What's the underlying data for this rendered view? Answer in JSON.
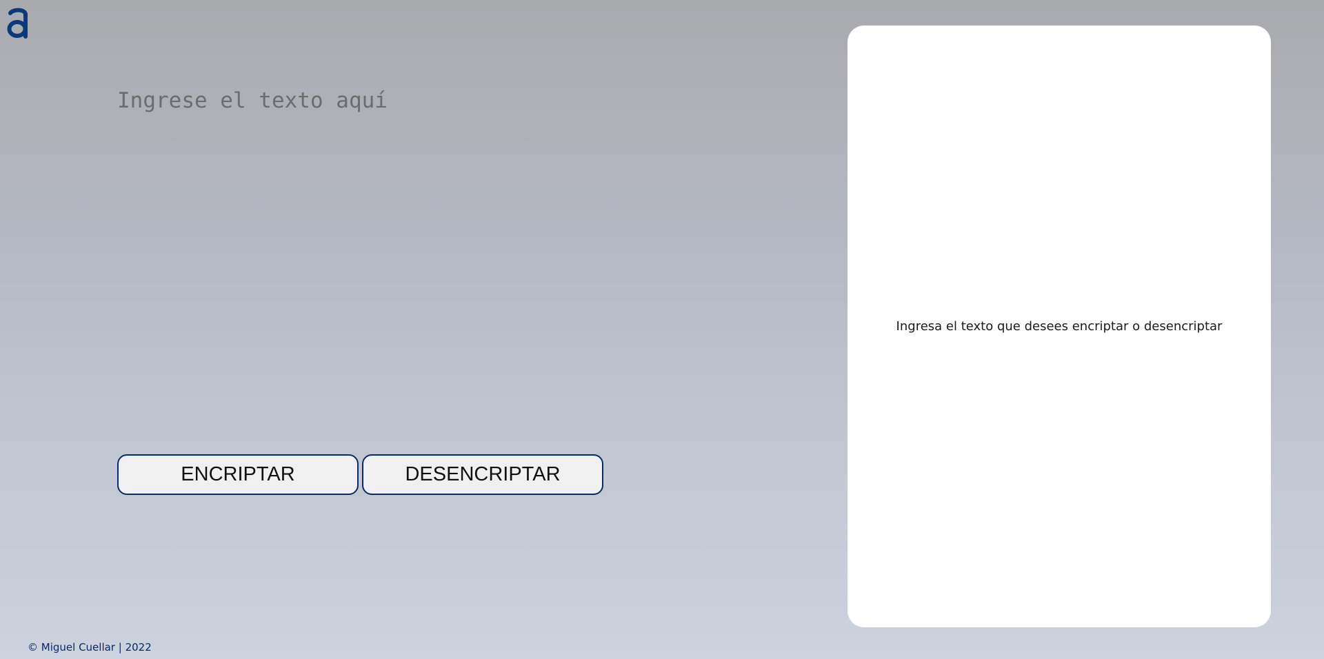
{
  "logo": {
    "icon": "letter-a-logo-icon",
    "color": "#0a3a7a"
  },
  "input": {
    "placeholder": "Ingrese el texto aquí",
    "value": ""
  },
  "buttons": {
    "encrypt_label": "ENCRIPTAR",
    "decrypt_label": "DESENCRIPTAR",
    "border_color": "#0a2a66"
  },
  "output": {
    "message": "Ingresa el texto que desees encriptar o desencriptar"
  },
  "footer": {
    "text": "© Miguel Cuellar | 2022"
  }
}
